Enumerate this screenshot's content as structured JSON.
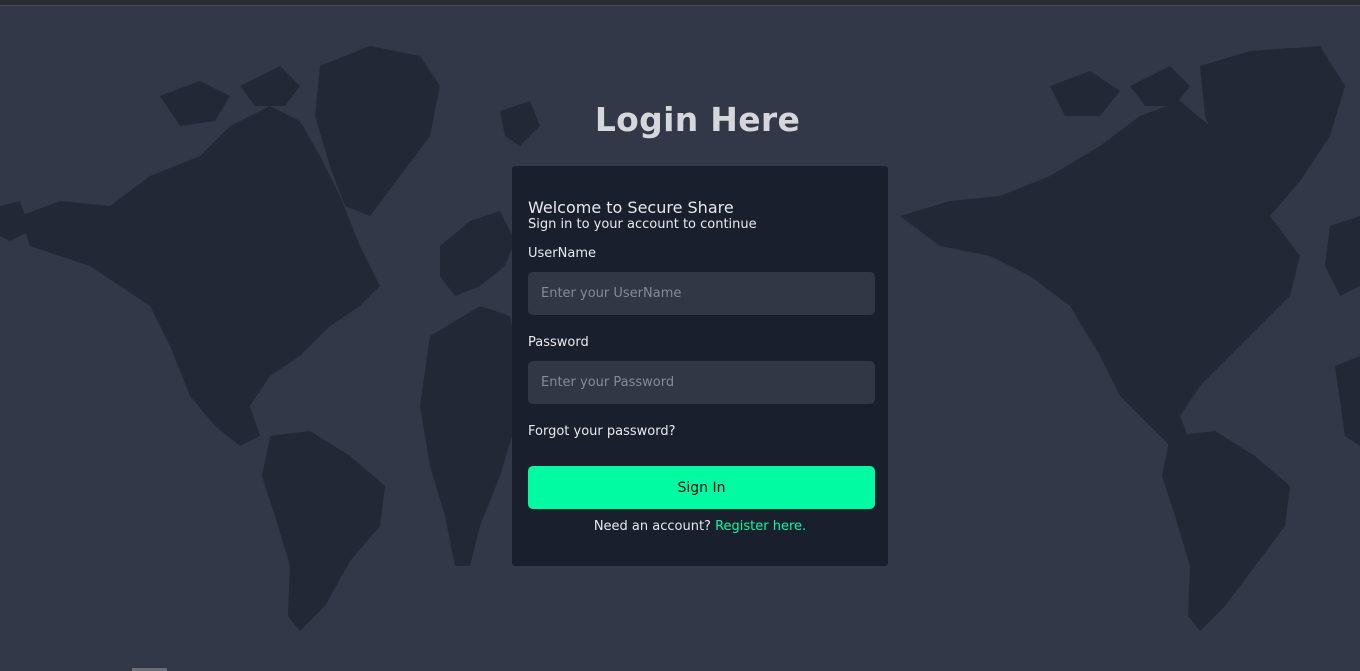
{
  "page": {
    "title": "Login Here"
  },
  "card": {
    "welcome": "Welcome to Secure Share",
    "subtitle": "Sign in to your account to continue",
    "username": {
      "label": "UserName",
      "placeholder": "Enter your UserName",
      "value": ""
    },
    "password": {
      "label": "Password",
      "placeholder": "Enter your Password",
      "value": ""
    },
    "forgot_label": "Forgot your password?",
    "signin_label": "Sign In",
    "register_prompt": "Need an account? ",
    "register_link": "Register here."
  },
  "colors": {
    "background": "#323848",
    "map_land": "#222836",
    "card": "#1a1f2e",
    "input": "#323746",
    "accent": "#00fba2",
    "title": "#d6d7db"
  }
}
